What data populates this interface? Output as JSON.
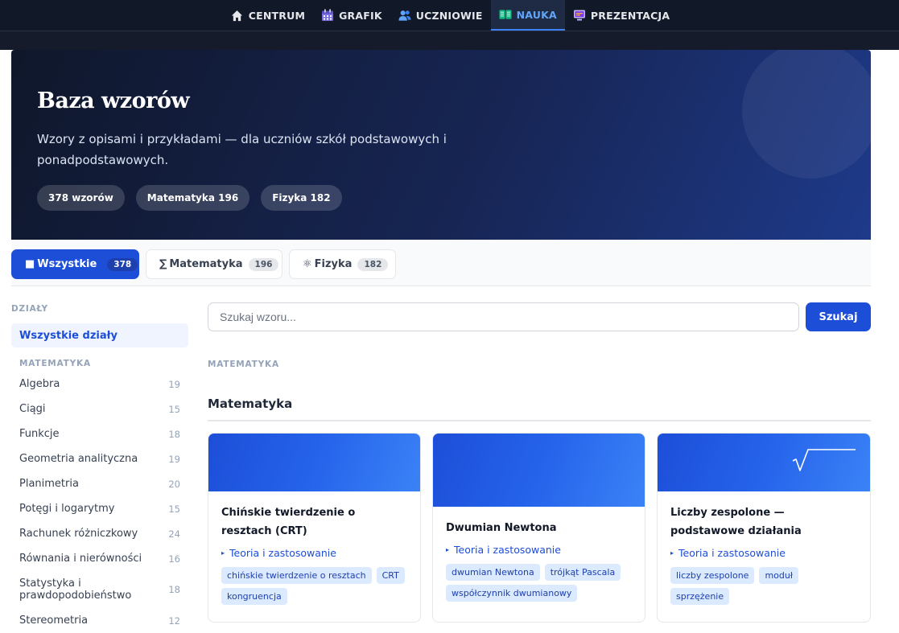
{
  "nav": {
    "items": [
      {
        "label": "CENTRUM",
        "icon": "home-icon"
      },
      {
        "label": "GRAFIK",
        "icon": "calendar-icon"
      },
      {
        "label": "UCZNIOWIE",
        "icon": "users-icon"
      },
      {
        "label": "NAUKA",
        "icon": "book-icon",
        "active": true
      },
      {
        "label": "PREZENTACJA",
        "icon": "presentation-icon"
      }
    ]
  },
  "hero": {
    "title": "Baza wzorów",
    "subtitle": "Wzory z opisami i przykładami — dla uczniów szkół podstawowych i ponadpodstawowych.",
    "chips": [
      "378 wzorów",
      "Matematyka 196",
      "Fizyka 182"
    ]
  },
  "tabs": [
    {
      "icon": "■",
      "label": "Wszystkie",
      "count": "378",
      "active": true
    },
    {
      "icon": "∑",
      "label": "Matematyka",
      "count": "196"
    },
    {
      "icon": "⚛",
      "label": "Fizyka",
      "count": "182"
    }
  ],
  "sidebar": {
    "heading": "DZIAŁY",
    "all_label": "Wszystkie działy",
    "group_label": "MATEMATYKA",
    "items": [
      {
        "label": "Algebra",
        "count": "19"
      },
      {
        "label": "Ciągi",
        "count": "15"
      },
      {
        "label": "Funkcje",
        "count": "18"
      },
      {
        "label": "Geometria analityczna",
        "count": "19"
      },
      {
        "label": "Planimetria",
        "count": "20"
      },
      {
        "label": "Potęgi i logarytmy",
        "count": "15"
      },
      {
        "label": "Rachunek różniczkowy",
        "count": "24"
      },
      {
        "label": "Równania i nierówności",
        "count": "16"
      },
      {
        "label": "Statystyka i prawdopodobieństwo",
        "count": "18"
      },
      {
        "label": "Stereometria",
        "count": "12"
      }
    ]
  },
  "search": {
    "placeholder": "Szukaj wzoru...",
    "value": "",
    "button_label": "Szukaj"
  },
  "main": {
    "section_label": "MATEMATYKA",
    "section_title": "Matematyka",
    "cards": [
      {
        "title": "Chińskie twierdzenie o resztach (CRT)",
        "category": "Teoria i zastosowanie",
        "tags": [
          "chińskie twierdzenie o resztach",
          "CRT",
          "kongruencja"
        ]
      },
      {
        "title": "Dwumian Newtona",
        "category": "Teoria i zastosowanie",
        "tags": [
          "dwumian Newtona",
          "trójkąt Pascala",
          "współczynnik dwumianowy"
        ]
      },
      {
        "title": "Liczby zespolone — podstawowe działania",
        "category": "Teoria i zastosowanie",
        "tags": [
          "liczby zespolone",
          "moduł",
          "sprzężenie"
        ],
        "banner_icon": "square-root-icon"
      }
    ]
  },
  "colors": {
    "accent": "#1d4ed8",
    "nav_bg": "#111827",
    "hero_start": "#0f172a",
    "hero_end": "#1e3a8a",
    "tag_bg": "#dbeafe"
  }
}
